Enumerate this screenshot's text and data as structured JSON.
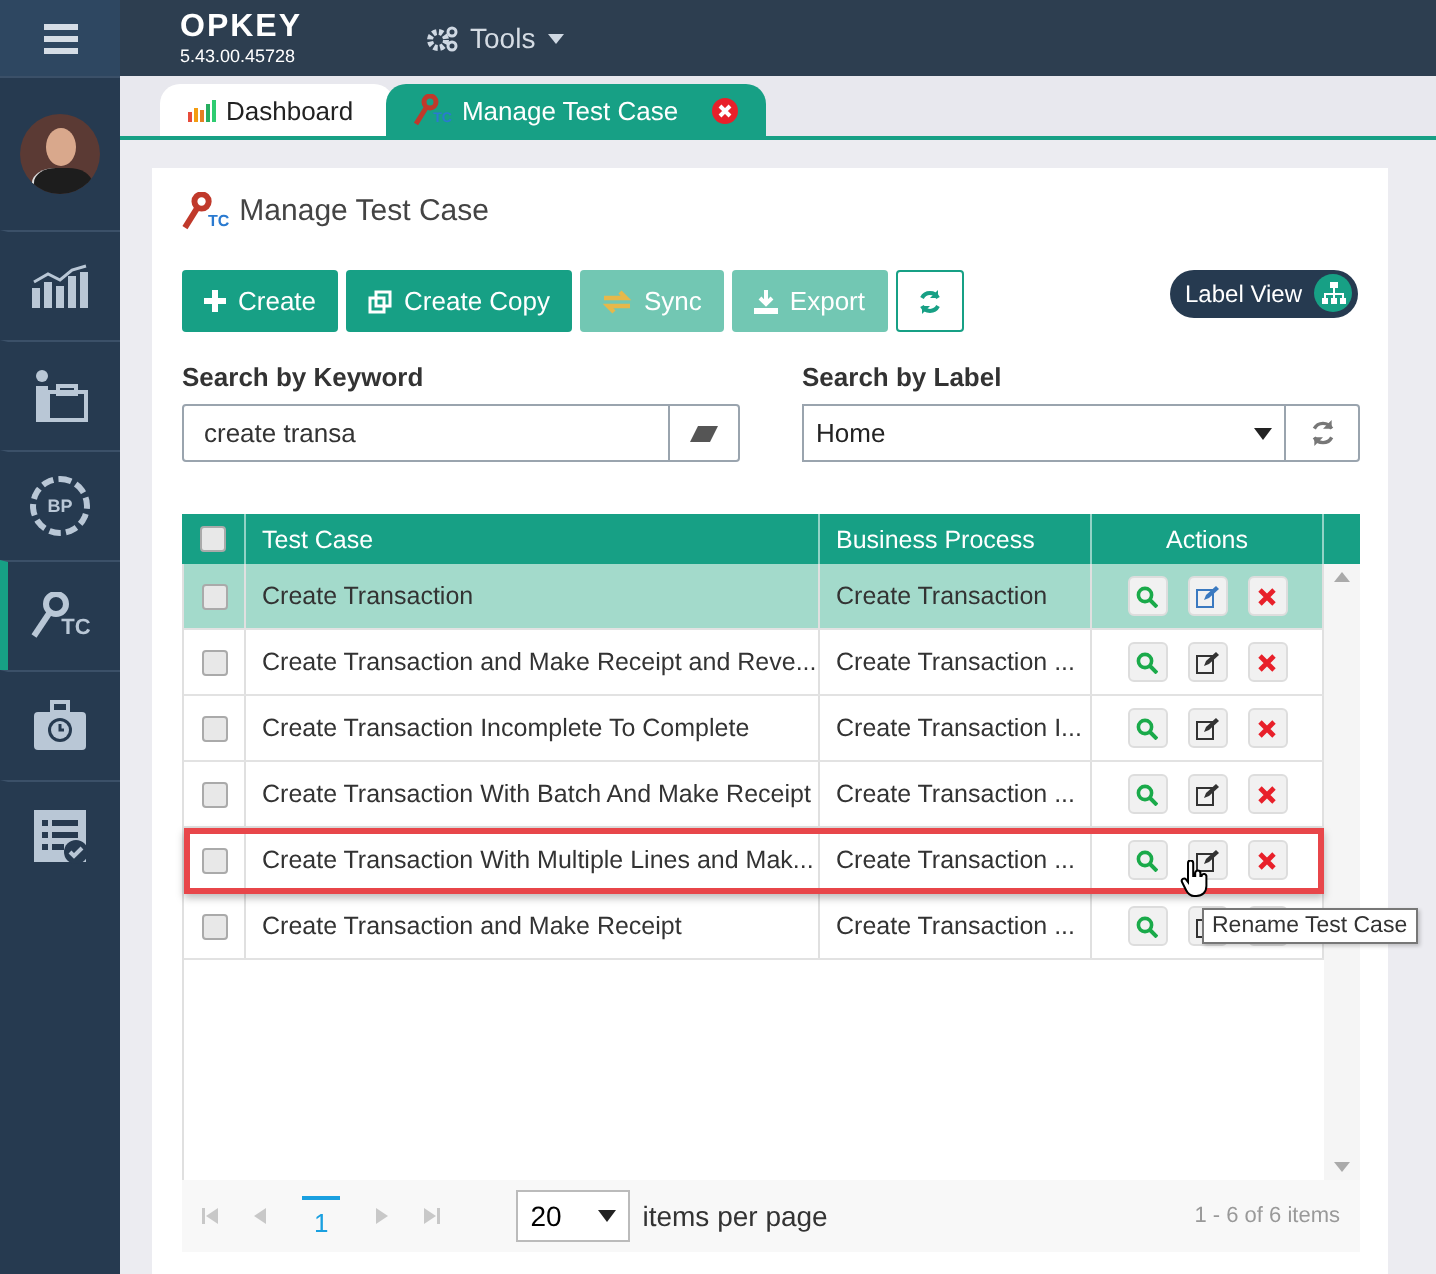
{
  "topbar": {
    "logo": "OPKEY",
    "version": "5.43.00.45728",
    "menu": "Tools"
  },
  "sidebar": {
    "items": [
      {
        "kind": "chart",
        "selected": false
      },
      {
        "kind": "presenter",
        "selected": false
      },
      {
        "kind": "bp",
        "icon_text": "BP",
        "selected": false
      },
      {
        "kind": "key",
        "icon_text": "TC",
        "selected": true
      },
      {
        "kind": "briefcase",
        "selected": false
      },
      {
        "kind": "checklist",
        "selected": false
      }
    ]
  },
  "tabs": [
    {
      "label": "Dashboard",
      "kind": "dashboard",
      "selected": false,
      "closable": false
    },
    {
      "label": "Manage Test Case",
      "kind": "key",
      "icon_text": "TC",
      "selected": true,
      "closable": true
    }
  ],
  "page": {
    "title": "Manage Test Case",
    "icon_text": "TC",
    "buttons": [
      {
        "label": "Create",
        "kind": "plus",
        "disabled": false
      },
      {
        "label": "Create Copy",
        "kind": "copy",
        "disabled": false
      },
      {
        "label": "Sync",
        "kind": "sync",
        "disabled": true
      },
      {
        "label": "Export",
        "kind": "export",
        "disabled": true
      }
    ],
    "label_view": "Label View",
    "keyword": {
      "label": "Search by Keyword",
      "value": "create transa"
    },
    "label_search": {
      "label": "Search by Label",
      "value": "Home"
    }
  },
  "table": {
    "columns": [
      "Test Case",
      "Business Process",
      "Actions"
    ],
    "all_checked": false,
    "rows": [
      {
        "test_case": "Create Transaction",
        "business_process": "Create Transaction",
        "checked": false,
        "selected": true,
        "highlighted": false
      },
      {
        "test_case": "Create Transaction and Make Receipt and Reve...",
        "business_process": "Create Transaction ...",
        "checked": false,
        "selected": false,
        "highlighted": false
      },
      {
        "test_case": "Create Transaction Incomplete To Complete",
        "business_process": "Create Transaction I...",
        "checked": false,
        "selected": false,
        "highlighted": false
      },
      {
        "test_case": "Create Transaction With Batch And Make Receipt",
        "business_process": "Create Transaction ...",
        "checked": false,
        "selected": false,
        "highlighted": false
      },
      {
        "test_case": "Create Transaction With Multiple Lines and Mak...",
        "business_process": "Create Transaction ...",
        "checked": false,
        "selected": false,
        "highlighted": true
      },
      {
        "test_case": "Create Transaction and Make Receipt",
        "business_process": "Create Transaction ...",
        "checked": false,
        "selected": false,
        "highlighted": false
      }
    ]
  },
  "tooltip": "Rename Test Case",
  "pager": {
    "page": "1",
    "page_size": "20",
    "per_page_label": "items per page",
    "summary": "1 - 6 of 6 items"
  }
}
